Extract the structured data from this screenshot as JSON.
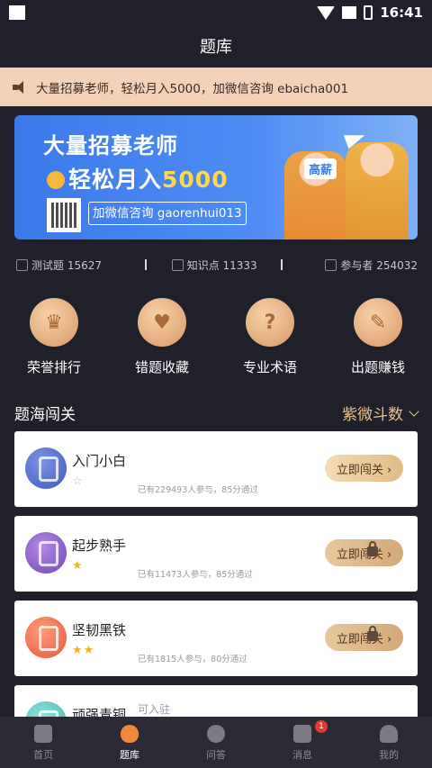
{
  "status_bar": {
    "time": "16:41"
  },
  "header": {
    "title": "题库"
  },
  "notice": {
    "text": "大量招募老师，轻松月入5000，加微信咨询 ebaicha001"
  },
  "banner": {
    "line1": "大量招募老师",
    "line2_prefix": "轻松月入",
    "line2_amount": "5000",
    "contact": "加微信咨询 gaorenhui013",
    "tag": "高薪"
  },
  "stats": [
    {
      "label": "测试题 15627"
    },
    {
      "label": "知识点 11333"
    },
    {
      "label": "参与者 254032"
    }
  ],
  "features": [
    {
      "label": "荣誉排行",
      "icon": "trophy-icon"
    },
    {
      "label": "错题收藏",
      "icon": "heart-folder-icon"
    },
    {
      "label": "专业术语",
      "icon": "question-book-icon"
    },
    {
      "label": "出题赚钱",
      "icon": "edit-doc-icon"
    }
  ],
  "section": {
    "title": "题海闯关",
    "filter": "紫微斗数"
  },
  "levels": [
    {
      "name": "入门小白",
      "stars": "☆",
      "meta": "已有229493人参与，85分通过",
      "action": "立即闯关 ›",
      "color": "#4a67c9",
      "locked": false
    },
    {
      "name": "起步熟手",
      "stars": "★",
      "meta": "已有11473人参与，85分通过",
      "action": "立即闯关 ›",
      "color": "#8a58c8",
      "locked": true
    },
    {
      "name": "坚韧黑铁",
      "stars": "★★",
      "meta": "已有1815人参与，80分通过",
      "action": "立即闯关 ›",
      "color": "#ee6a4b",
      "locked": true
    },
    {
      "name": "顽强青铜",
      "stars": "",
      "meta": "",
      "action": "",
      "color": "#5fc6c2",
      "locked": true
    }
  ],
  "partial_label": "可入驻",
  "tabs": [
    {
      "label": "首页",
      "icon": "home-icon",
      "active": false
    },
    {
      "label": "题库",
      "icon": "quiz-bank-icon",
      "active": true
    },
    {
      "label": "问答",
      "icon": "qa-icon",
      "active": false
    },
    {
      "label": "消息",
      "icon": "message-icon",
      "active": false,
      "badge": "1"
    },
    {
      "label": "我的",
      "icon": "profile-icon",
      "active": false
    }
  ]
}
